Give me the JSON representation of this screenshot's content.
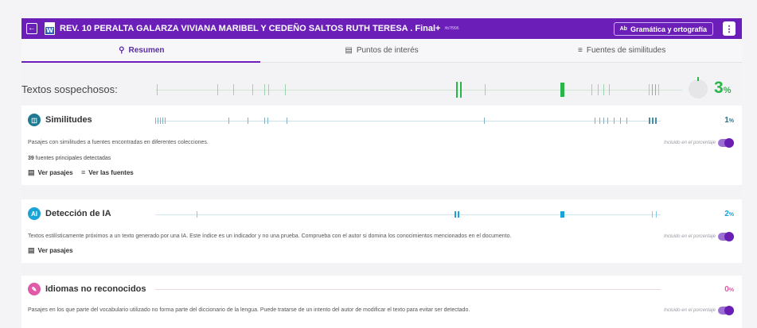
{
  "header": {
    "title": "REV. 10 PERALTA GALARZA VIVIANA MARIBEL Y CEDEÑO SALTOS RUTH TERESA . Final+",
    "doc_id": "#b7f996",
    "grammar_button": "Gramática y ortografía",
    "grammar_icon": "Ab",
    "back_icon": "arrow-left-icon",
    "menu_icon": "vertical-dots-icon",
    "colors": {
      "brand": "#6b1fb8",
      "green": "#2ab54a",
      "teal": "#4a9bb5",
      "cyan": "#19a3d6",
      "pink": "#e05aa8"
    }
  },
  "tabs": [
    {
      "label": "Resumen",
      "icon": "magnifier-icon",
      "active": true
    },
    {
      "label": "Puntos de interés",
      "icon": "document-list-icon",
      "active": false
    },
    {
      "label": "Fuentes de similitudes",
      "icon": "list-icon",
      "active": false
    }
  ],
  "suspicious": {
    "label": "Textos sospechosos:",
    "percent": "3",
    "percent_sign": "%"
  },
  "similitudes": {
    "title": "Similitudes",
    "percent": "1",
    "percent_sign": "%",
    "description": "Pasajes con similitudes a fuentes encontradas en diferentes colecciones.",
    "included_label": "Incluido en el porcentaje",
    "sources_count": "39",
    "sources_text": " fuentes principales detectadas",
    "link_passages": "Ver pasajes",
    "link_sources": "Ver las fuentes"
  },
  "ia": {
    "title": "Detección de IA",
    "percent": "2",
    "percent_sign": "%",
    "description": "Textos estilísticamente próximos a un texto generado por una IA. Este índice es un indicador y no una prueba. Comprueba con el autor si domina los conocimientos mencionados en el documento.",
    "included_label": "Incluido en el porcentaje",
    "link_passages": "Ver pasajes"
  },
  "idiomas": {
    "title": "Idiomas no reconocidos",
    "percent": "0",
    "percent_sign": "%",
    "description": "Pasajes en los que parte del vocabulario utilizado no forma parte del diccionario de la lengua. Puede tratarse de un intento del autor de modificar el texto para evitar ser detectado.",
    "included_label": "Incluido en el porcentaje"
  }
}
